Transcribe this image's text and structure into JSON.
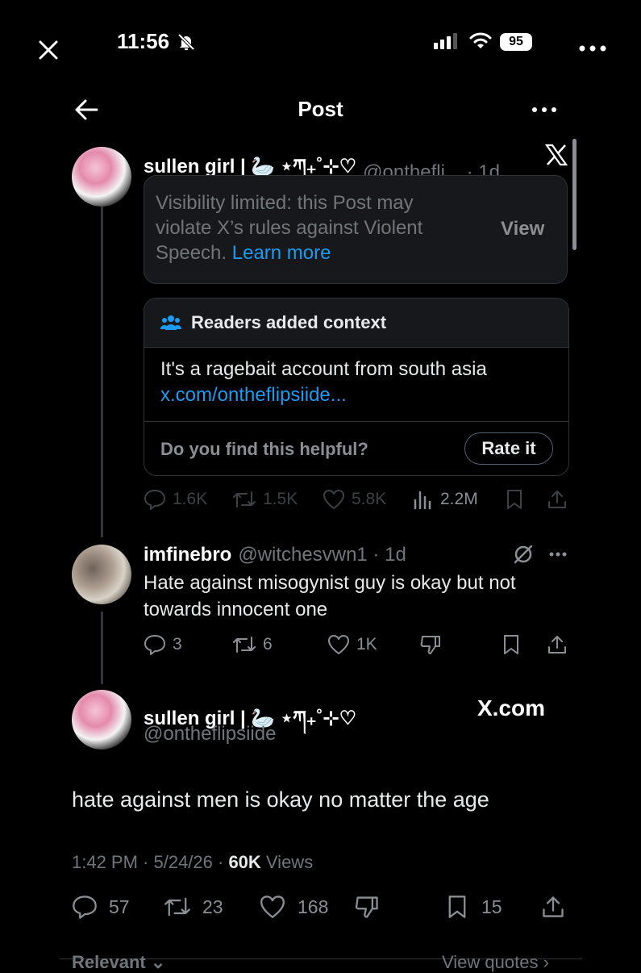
{
  "status_bar": {
    "time": "11:56",
    "battery": "95"
  },
  "header": {
    "title": "Post"
  },
  "quoted_post": {
    "author": "sullen girl | 🦢 ⋆ཀ₊˚⊹♡",
    "handle_time": "@onthefli... · 1d",
    "visibility_text": "Visibility limited: this Post may violate X’s rules against Violent Speech.",
    "learn_more": "Learn more",
    "view_label": "View",
    "context_header": "Readers added context",
    "context_text": "It's a ragebait account from south asia",
    "context_link": "x.com/ontheflipsiide...",
    "helpful_question": "Do you find this helpful?",
    "rate_label": "Rate it",
    "stats": {
      "replies": "1.6K",
      "reposts": "1.5K",
      "likes": "5.8K",
      "views": "2.2M"
    }
  },
  "reply_post": {
    "author": "imfinebro",
    "handle_time": "@witchesvwn1 · 1d",
    "text": "Hate against misogynist guy is okay but not towards innocent one",
    "stats": {
      "replies": "3",
      "reposts": "6",
      "likes": "1K"
    }
  },
  "main_post": {
    "author": "sullen girl | 🦢 ⋆ཀ₊˚⊹♡",
    "handle": "@ontheflipsiide",
    "source_badge": "X.com",
    "text": "hate against men is okay no matter the age",
    "meta_time": "1:42 PM · 5/24/26 · ",
    "meta_views_count": "60K",
    "meta_views_label": " Views",
    "stats": {
      "replies": "57",
      "reposts": "23",
      "likes": "168",
      "bookmarks": "15"
    }
  },
  "bottom": {
    "relevant": "Relevant ⌄",
    "view_quotes": "View quotes ›"
  },
  "colors": {
    "link": "#1d9bf0",
    "card_bg": "#16181c",
    "border": "#2f3336",
    "muted": "#71767b"
  }
}
